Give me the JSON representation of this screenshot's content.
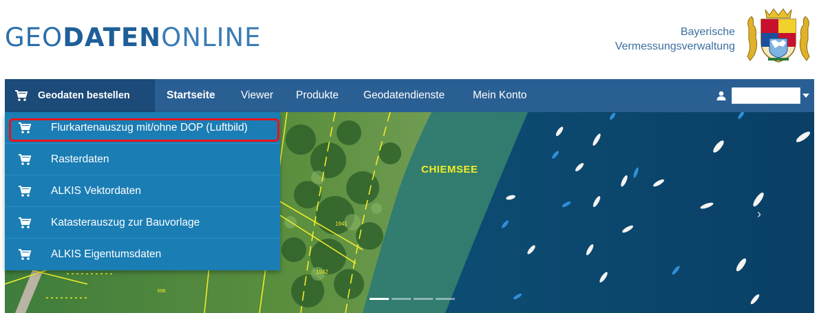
{
  "header": {
    "logo": {
      "part1": "GEO",
      "part2": "DATEN",
      "part3": "ONLINE"
    },
    "agency_line1": "Bayerische",
    "agency_line2": "Vermessungsverwaltung",
    "crest_icon": "bavarian-coat-of-arms-icon"
  },
  "nav": {
    "order_label": "Geodaten bestellen",
    "links": [
      {
        "label": "Startseite",
        "active": true
      },
      {
        "label": "Viewer",
        "active": false
      },
      {
        "label": "Produkte",
        "active": false
      },
      {
        "label": "Geodatendienste",
        "active": false
      },
      {
        "label": "Mein Konto",
        "active": false
      }
    ],
    "user_icon": "user-icon"
  },
  "dropdown": {
    "items": [
      {
        "label": "Flurkartenauszug mit/ohne DOP (Luftbild)",
        "highlighted": true
      },
      {
        "label": "Rasterdaten"
      },
      {
        "label": "ALKIS Vektordaten"
      },
      {
        "label": "Katasterauszug zur Bauvorlage"
      },
      {
        "label": "ALKIS Eigentumsdaten"
      }
    ]
  },
  "hero": {
    "map_label": "CHIEMSEE",
    "parcel_numbers": [
      "1941",
      "1942",
      "696"
    ],
    "slides": 4,
    "active_slide": 1
  },
  "colors": {
    "logo_blue": "#2b6fa9",
    "nav_bg": "#2a5f93",
    "nav_order_bg": "#1c4a79",
    "dropdown_bg": "#1a7db4",
    "highlight_red": "#e8131b",
    "map_label_yellow": "#f2ec2a"
  }
}
